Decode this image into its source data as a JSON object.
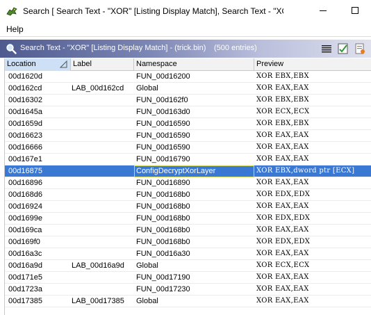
{
  "window": {
    "title": "Search [ Search Text - \"XOR\"  [Listing Display Match], Search Text - \"XO..."
  },
  "menu": {
    "help": "Help"
  },
  "panel": {
    "title": "Search Text - \"XOR\"  [Listing Display Match] - (trick.bin)",
    "entries": "(500 entries)"
  },
  "columns": {
    "location": "Location",
    "label": "Label",
    "namespace": "Namespace",
    "preview": "Preview"
  },
  "rows": [
    {
      "location": "00d1620d",
      "label": "",
      "namespace": "FUN_00d16200",
      "preview": "XOR EBX,EBX"
    },
    {
      "location": "00d162cd",
      "label": "LAB_00d162cd",
      "namespace": "Global",
      "preview": "XOR EAX,EAX"
    },
    {
      "location": "00d16302",
      "label": "",
      "namespace": "FUN_00d162f0",
      "preview": "XOR EBX,EBX"
    },
    {
      "location": "00d1645a",
      "label": "",
      "namespace": "FUN_00d163d0",
      "preview": "XOR ECX,ECX"
    },
    {
      "location": "00d1659d",
      "label": "",
      "namespace": "FUN_00d16590",
      "preview": "XOR EBX,EBX"
    },
    {
      "location": "00d16623",
      "label": "",
      "namespace": "FUN_00d16590",
      "preview": "XOR EAX,EAX"
    },
    {
      "location": "00d16666",
      "label": "",
      "namespace": "FUN_00d16590",
      "preview": "XOR EAX,EAX"
    },
    {
      "location": "00d167e1",
      "label": "",
      "namespace": "FUN_00d16790",
      "preview": "XOR EAX,EAX"
    },
    {
      "location": "00d16875",
      "label": "",
      "namespace": "ConfigDecryptXorLayer",
      "preview": "XOR EBX,dword ptr [ECX]"
    },
    {
      "location": "00d16896",
      "label": "",
      "namespace": "FUN_00d16890",
      "preview": "XOR EAX,EAX"
    },
    {
      "location": "00d168d6",
      "label": "",
      "namespace": "FUN_00d168b0",
      "preview": "XOR EDX,EDX"
    },
    {
      "location": "00d16924",
      "label": "",
      "namespace": "FUN_00d168b0",
      "preview": "XOR EAX,EAX"
    },
    {
      "location": "00d1699e",
      "label": "",
      "namespace": "FUN_00d168b0",
      "preview": "XOR EDX,EDX"
    },
    {
      "location": "00d169ca",
      "label": "",
      "namespace": "FUN_00d168b0",
      "preview": "XOR EAX,EAX"
    },
    {
      "location": "00d169f0",
      "label": "",
      "namespace": "FUN_00d168b0",
      "preview": "XOR EDX,EDX"
    },
    {
      "location": "00d16a3c",
      "label": "",
      "namespace": "FUN_00d16a30",
      "preview": "XOR EAX,EAX"
    },
    {
      "location": "00d16a9d",
      "label": "LAB_00d16a9d",
      "namespace": "Global",
      "preview": "XOR ECX,ECX"
    },
    {
      "location": "00d171e5",
      "label": "",
      "namespace": "FUN_00d17190",
      "preview": "XOR EAX,EAX"
    },
    {
      "location": "00d1723a",
      "label": "",
      "namespace": "FUN_00d17230",
      "preview": "XOR EAX,EAX"
    },
    {
      "location": "00d17385",
      "label": "LAB_00d17385",
      "namespace": "Global",
      "preview": "XOR EAX,EAX"
    }
  ],
  "selected_row": 8,
  "colors": {
    "selection": "#3a79d3",
    "panel_gradient_start": "#4f5a8f"
  }
}
